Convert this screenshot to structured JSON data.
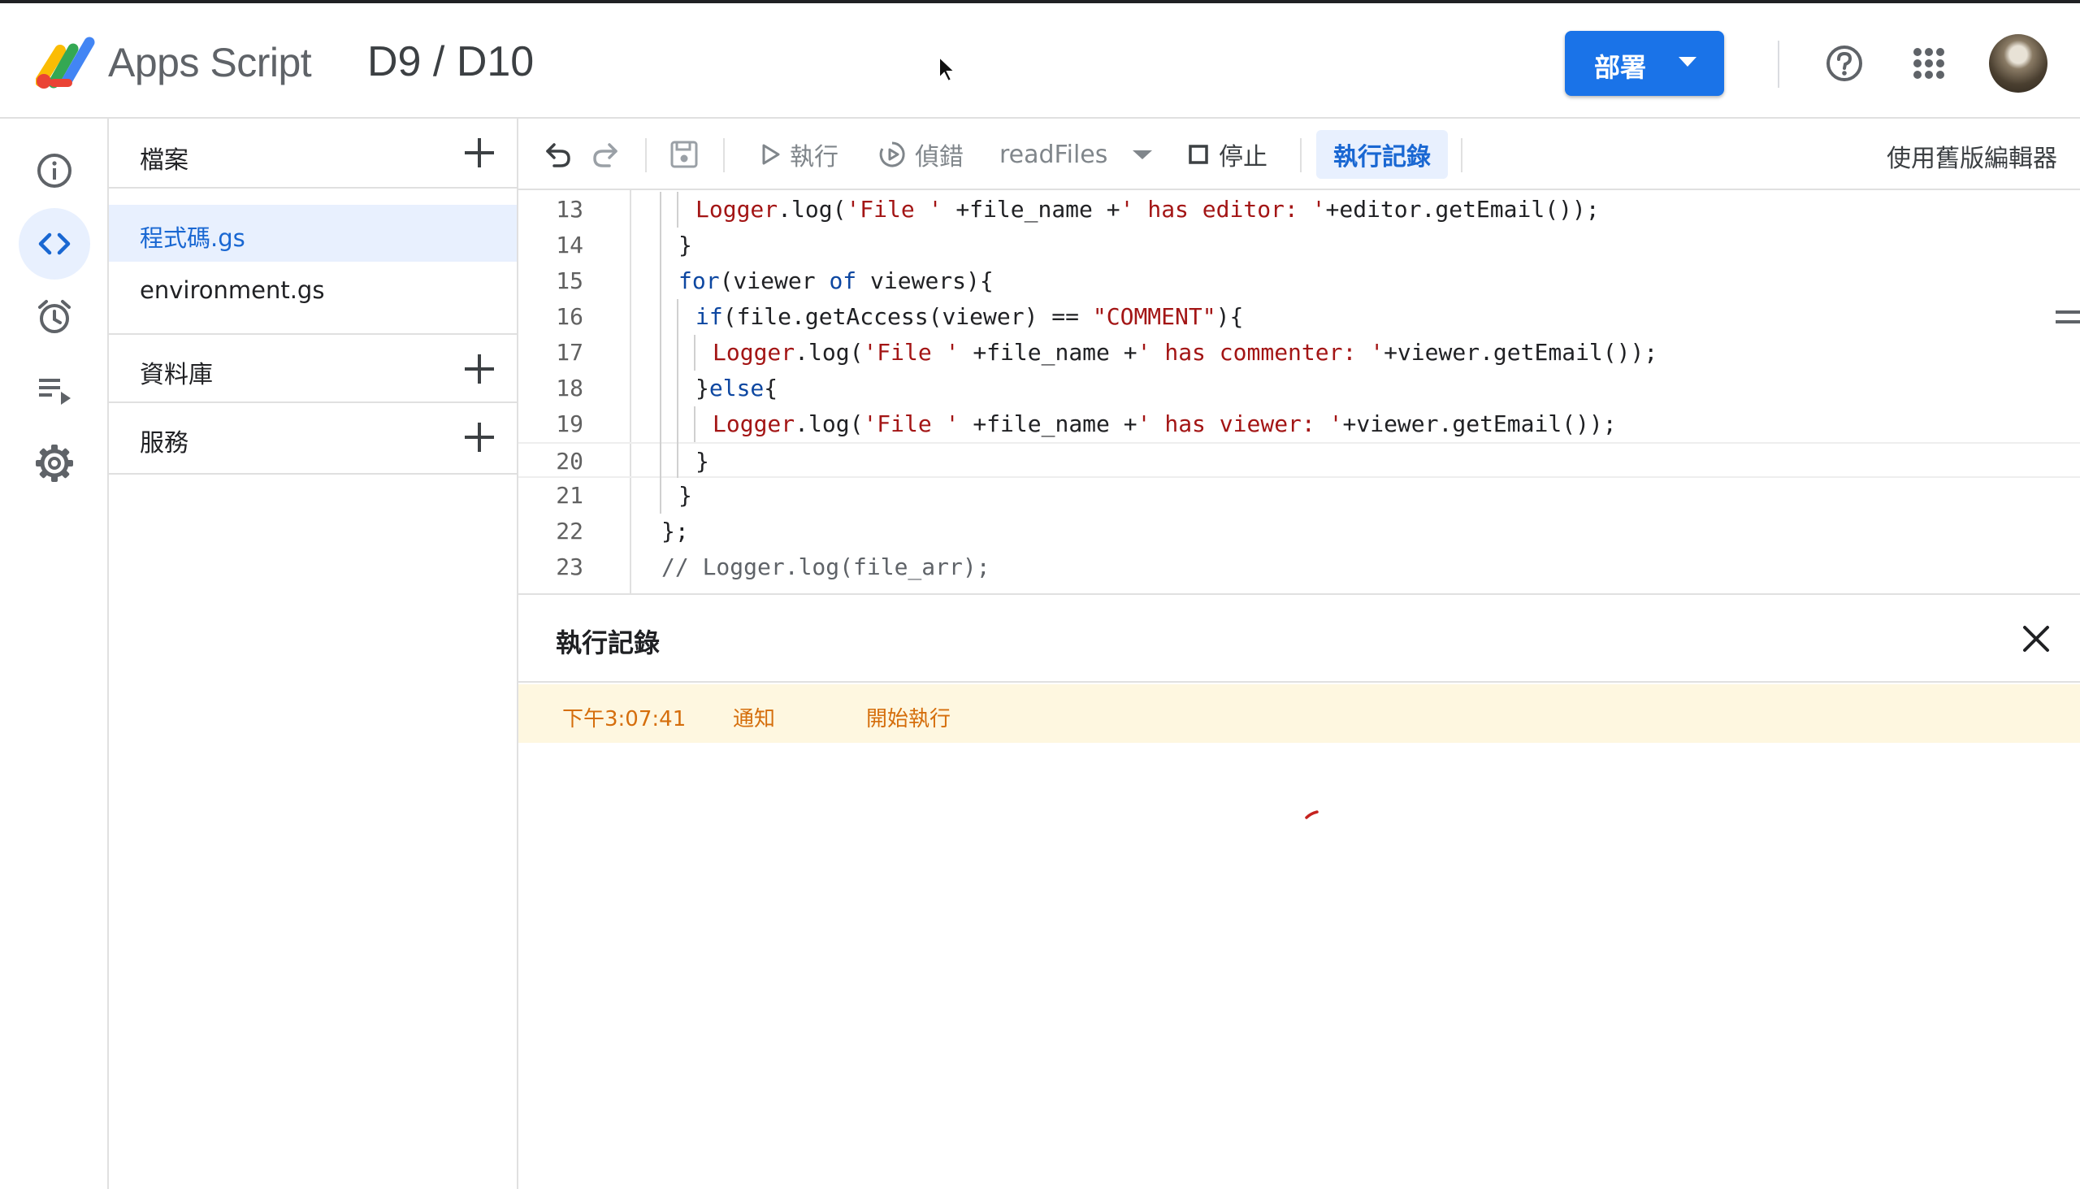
{
  "app": {
    "brand": "Apps Script",
    "project_title": "D9 / D10"
  },
  "header": {
    "deploy_label": "部署",
    "icons": [
      "help-icon",
      "apps-grid-icon",
      "avatar"
    ]
  },
  "rail": {
    "items": [
      {
        "name": "overview",
        "icon": "info-icon"
      },
      {
        "name": "editor",
        "icon": "code-icon",
        "active": true
      },
      {
        "name": "triggers",
        "icon": "alarm-clock-icon"
      },
      {
        "name": "executions",
        "icon": "executions-list-icon"
      },
      {
        "name": "settings",
        "icon": "gear-icon"
      }
    ]
  },
  "files_panel": {
    "files_title": "檔案",
    "files": [
      {
        "label": "程式碼.gs",
        "active": true
      },
      {
        "label": "environment.gs",
        "active": false
      }
    ],
    "libraries_title": "資料庫",
    "services_title": "服務"
  },
  "toolbar": {
    "run_label": "執行",
    "debug_label": "偵錯",
    "function_select": "readFiles",
    "stop_label": "停止",
    "exec_log_label": "執行記錄",
    "legacy_editor_label": "使用舊版編輯器"
  },
  "editor": {
    "current_line": 20,
    "lines": [
      {
        "no": "13",
        "indent": 2,
        "text": "Logger.log('File ' +file_name +' has editor: '+editor.getEmail());"
      },
      {
        "no": "14",
        "indent": 1,
        "text": "}"
      },
      {
        "no": "15",
        "indent": 1,
        "text": "for(viewer of viewers){"
      },
      {
        "no": "16",
        "indent": 2,
        "text": "if(file.getAccess(viewer) == \"COMMENT\"){"
      },
      {
        "no": "17",
        "indent": 3,
        "text": "Logger.log('File ' +file_name +' has commenter: '+viewer.getEmail());"
      },
      {
        "no": "18",
        "indent": 2,
        "text": "}else{"
      },
      {
        "no": "19",
        "indent": 3,
        "text": "Logger.log('File ' +file_name +' has viewer: '+viewer.getEmail());"
      },
      {
        "no": "20",
        "indent": 2,
        "text": "}"
      },
      {
        "no": "21",
        "indent": 1,
        "text": "}"
      },
      {
        "no": "22",
        "indent": 0,
        "text": "};"
      },
      {
        "no": "23",
        "indent": 0,
        "text": "// Logger.log(file_arr);"
      }
    ]
  },
  "execution_log": {
    "title": "執行記錄",
    "entries": [
      {
        "time": "下午3:07:41",
        "level": "通知",
        "message": "開始執行"
      }
    ]
  },
  "colors": {
    "accent": "#1a73e8",
    "active_bg": "#e8f0fe",
    "active_text": "#1967d2",
    "log_notice_bg": "#fef7e0",
    "log_notice_text": "#d56e0c",
    "code_string": "#a31515",
    "code_keyword": "#0d47a1"
  }
}
